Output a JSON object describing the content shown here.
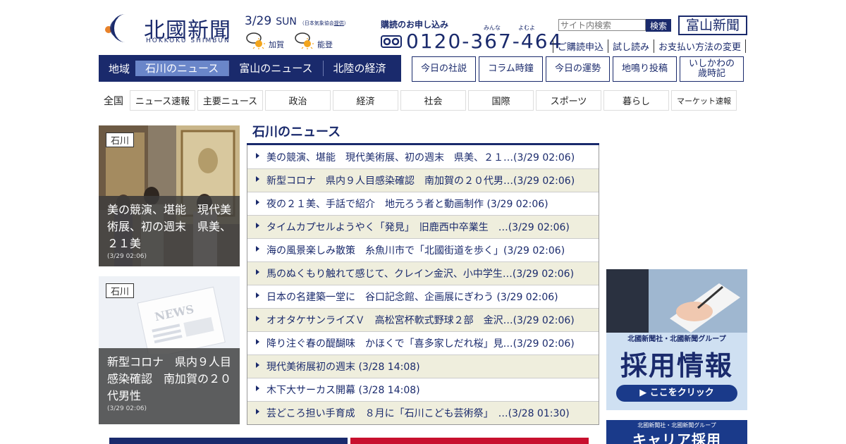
{
  "brand": {
    "name": "北國新聞",
    "sub": "HOKKOKU SHIMBUN"
  },
  "date": {
    "md": "3/29",
    "dow": "SUN",
    "source_prefix": "（日本気象協会",
    "source_link": "提供",
    "source_suffix": "）"
  },
  "weather": [
    {
      "area": "加賀",
      "icon": "cloud-sun-icon"
    },
    {
      "area": "能登",
      "icon": "cloud-sun-icon"
    }
  ],
  "subscription": {
    "title": "購読のお申し込み",
    "ruby1": "みんな",
    "ruby2": "よむよ",
    "phone": "0120-367-464"
  },
  "search": {
    "placeholder": "サイト内検索",
    "button": "検索"
  },
  "toyama_button": "富山新聞",
  "top_links": [
    "ご購読申込",
    "試し読み",
    "お支払い方法の変更"
  ],
  "region_nav": {
    "label": "地域",
    "items": [
      "石川のニュース",
      "富山のニュース",
      "北陸の経済"
    ]
  },
  "column_buttons": [
    "今日の社説",
    "コラム時鐘",
    "今日の運勢",
    "地鳴り投稿",
    "いしかわの\n歳時記"
  ],
  "category": {
    "label": "全国",
    "items": [
      "ニュース速報",
      "主要ニュース",
      "政治",
      "経済",
      "社会",
      "国際",
      "スポーツ",
      "暮らし",
      "マーケット速報"
    ]
  },
  "cards": [
    {
      "tag": "石川",
      "caption": "美の競演、堪能　現代美術展、初の週末　県美、２１美",
      "time": "(3/29 02:06)"
    },
    {
      "tag": "石川",
      "caption": "新型コロナ　県内９人目感染確認　南加賀の２０代男性",
      "time": "(3/29 02:06)"
    }
  ],
  "news": {
    "heading": "石川のニュース",
    "items": [
      "美の競演、堪能　現代美術展、初の週末　県美、２１…(3/29 02:06)",
      "新型コロナ　県内９人目感染確認　南加賀の２０代男…(3/29 02:06)",
      "夜の２１美、手話で紹介　地元ろう者と動画制作 (3/29 02:06)",
      "タイムカプセルようやく「発見」　旧鹿西中卒業生　…(3/29 02:06)",
      "海の風景楽しみ散策　糸魚川市で「北國街道を歩く」(3/29 02:06)",
      "馬のぬくもり触れて感じて、クレイン金沢、小中学生…(3/29 02:06)",
      "日本の名建築一堂に　谷口記念館、企画展にぎわう (3/29 02:06)",
      "オオタケサンライズＶ　高松宮杯軟式野球２部　金沢…(3/29 02:06)",
      "降り注ぐ春の醍醐味　かほくで「喜多家しだれ桜」見…(3/29 02:06)",
      "現代美術展初の週末 (3/28 14:08)",
      "木下大サーカス開幕 (3/28 14:08)",
      "芸どころ担い手育成　８月に「石川こども芸術祭」　…(3/28 01:30)"
    ]
  },
  "ads": {
    "recruit": {
      "group": "北國新聞社・北國新聞グループ",
      "title": "採用情報",
      "cta": "▶ ここをクリック"
    },
    "career": {
      "group": "北國新聞社・北國新聞グループ",
      "title": "キャリア採用"
    }
  },
  "colors": {
    "navy": "#1a2a6c",
    "active": "#6a86c9",
    "stripe": "#efeedd"
  }
}
